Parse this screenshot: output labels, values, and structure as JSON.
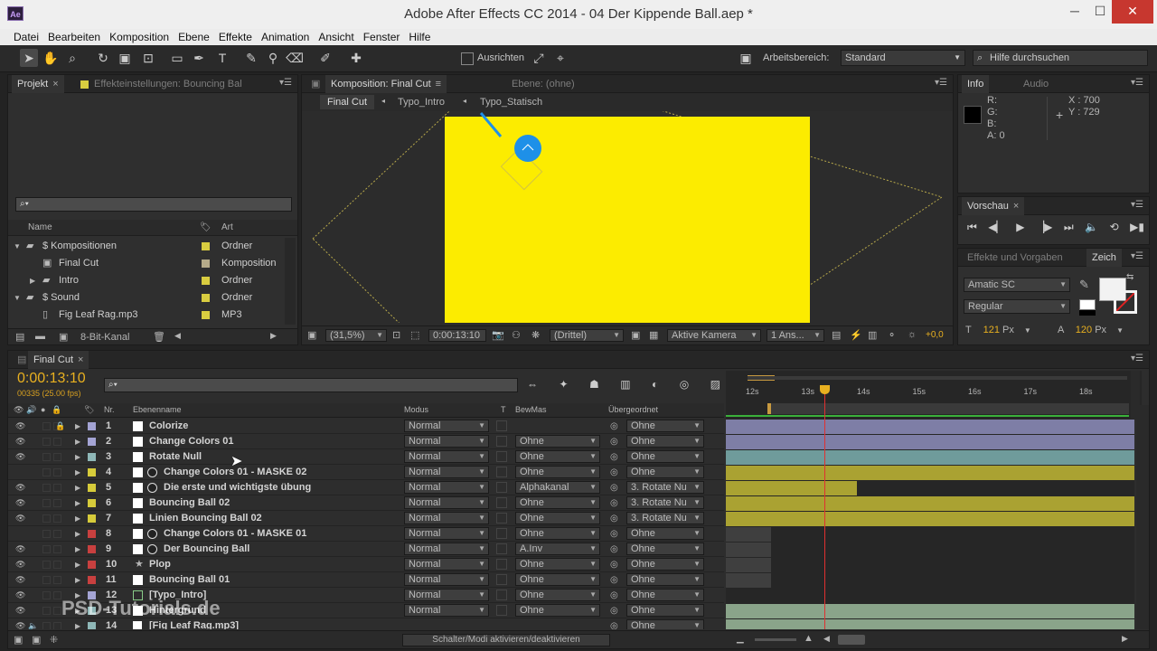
{
  "window": {
    "title": "Adobe After Effects CC 2014 - 04 Der Kippende Ball.aep *",
    "logo": "Ae",
    "min": "─",
    "max": "☐",
    "close": "✕"
  },
  "menu": [
    "Datei",
    "Bearbeiten",
    "Komposition",
    "Ebene",
    "Effekte",
    "Animation",
    "Ansicht",
    "Fenster",
    "Hilfe"
  ],
  "toolbar": {
    "align_label": "Ausrichten",
    "workspace_label": "Arbeitsbereich:",
    "workspace_value": "Standard",
    "help_search": "Hilfe durchsuchen"
  },
  "project": {
    "tab_project": "Projekt",
    "tab_effects": "Effekteinstellungen: Bouncing Bal",
    "search_placeholder": "⌕▾",
    "col_name": "Name",
    "col_type": "Art",
    "items": [
      {
        "name": "$ Kompositionen",
        "type": "Ordner",
        "color": "#d9cd40",
        "kind": "folder",
        "indent": 0
      },
      {
        "name": "Final Cut",
        "type": "Komposition",
        "color": "#b6ab8a",
        "kind": "comp",
        "indent": 1
      },
      {
        "name": "Intro",
        "type": "Ordner",
        "color": "#d9cd40",
        "kind": "folder",
        "indent": 1
      },
      {
        "name": "$ Sound",
        "type": "Ordner",
        "color": "#d9cd40",
        "kind": "folder",
        "indent": 0
      },
      {
        "name": "Fig Leaf Rag.mp3",
        "type": "MP3",
        "color": "#d9cd40",
        "kind": "file",
        "indent": 1
      }
    ],
    "bit_depth": "8-Bit-Kanal"
  },
  "composition": {
    "tab_comp": "Komposition: Final Cut",
    "tab_layer": "Ebene: (ohne)",
    "breadcrumbs": [
      "Final Cut",
      "Typo_Intro",
      "Typo_Statisch"
    ],
    "zoom": "(31,5%)",
    "timecode": "0:00:13:10",
    "grid": "(Drittel)",
    "camera": "Aktive Kamera",
    "views": "1 Ans...",
    "offset": "+0,0",
    "canvas_color": "#fcec00",
    "ball_color": "#1e90e8"
  },
  "info": {
    "tab_info": "Info",
    "tab_audio": "Audio",
    "r": "R:",
    "g": "G:",
    "b": "B:",
    "a": "A:",
    "a_val": "0",
    "x": "X : 700",
    "y": "Y : 729"
  },
  "preview": {
    "tab": "Vorschau"
  },
  "character": {
    "tab_effects": "Effekte und Vorgaben",
    "tab_char": "Zeich",
    "font": "Amatic SC",
    "style": "Regular",
    "size": "121",
    "size_unit": "Px",
    "leading": "120",
    "leading_unit": "Px"
  },
  "timeline": {
    "tab": "Final Cut",
    "timecode": "0:00:13:10",
    "frames": "00335 (25.00 fps)",
    "col_nr": "Nr.",
    "col_name": "Ebenenname",
    "col_mode": "Modus",
    "col_t": "T",
    "col_trkmat": "BewMas",
    "col_parent": "Übergeordnet",
    "ruler": [
      "12s",
      "13s",
      "14s",
      "15s",
      "16s",
      "17s",
      "18s",
      "1"
    ],
    "toggle_label": "Schalter/Modi aktivieren/deaktivieren",
    "layers": [
      {
        "nr": "1",
        "name": "Colorize",
        "mode": "Normal",
        "trkmat": "",
        "parent": "Ohne",
        "color": "#a4a4d4",
        "bar": "#7e7ea6",
        "start": 0.0,
        "end": 1.0
      },
      {
        "nr": "2",
        "name": "Change Colors 01",
        "mode": "Normal",
        "trkmat": "Ohne",
        "parent": "Ohne",
        "color": "#a4a4d4",
        "bar": "#7e7ea6",
        "start": 0.0,
        "end": 1.0
      },
      {
        "nr": "3",
        "name": "Rotate Null",
        "mode": "Normal",
        "trkmat": "Ohne",
        "parent": "Ohne",
        "color": "#8fb8b8",
        "bar": "#6f9b9b",
        "start": 0.0,
        "end": 1.0
      },
      {
        "nr": "4",
        "name": "Change Colors 01 - MASKE 02",
        "mode": "Normal",
        "trkmat": "Ohne",
        "parent": "Ohne",
        "color": "#d6cb3a",
        "bar": "#aaa232",
        "start": 0.0,
        "end": 1.0
      },
      {
        "nr": "5",
        "name": "Die erste und wichtigste übung",
        "mode": "Normal",
        "trkmat": "Alphakanal",
        "parent": "3. Rotate Nu",
        "color": "#d6cb3a",
        "bar": "#aaa232",
        "start": 0.0,
        "end": 0.32
      },
      {
        "nr": "6",
        "name": "Bouncing Ball 02",
        "mode": "Normal",
        "trkmat": "Ohne",
        "parent": "3. Rotate Nu",
        "color": "#d6cb3a",
        "bar": "#aaa232",
        "start": 0.0,
        "end": 1.0
      },
      {
        "nr": "7",
        "name": "Linien Bouncing Ball 02",
        "mode": "Normal",
        "trkmat": "Ohne",
        "parent": "3. Rotate Nu",
        "color": "#d6cb3a",
        "bar": "#aaa232",
        "start": 0.0,
        "end": 1.0
      },
      {
        "nr": "8",
        "name": "Change Colors 01 - MASKE 01",
        "mode": "Normal",
        "trkmat": "Ohne",
        "parent": "Ohne",
        "color": "#c8403f",
        "bar": "#3f3f3f",
        "start": 0.0,
        "end": 0.11
      },
      {
        "nr": "9",
        "name": "Der Bouncing Ball",
        "mode": "Normal",
        "trkmat": "A.Inv",
        "parent": "Ohne",
        "color": "#c8403f",
        "bar": "#3f3f3f",
        "start": 0.0,
        "end": 0.11
      },
      {
        "nr": "10",
        "name": "Plop",
        "mode": "Normal",
        "trkmat": "Ohne",
        "parent": "Ohne",
        "color": "#c8403f",
        "bar": "#3f3f3f",
        "start": 0.0,
        "end": 0.11
      },
      {
        "nr": "11",
        "name": "Bouncing Ball 01",
        "mode": "Normal",
        "trkmat": "Ohne",
        "parent": "Ohne",
        "color": "#c8403f",
        "bar": "#3f3f3f",
        "start": 0.0,
        "end": 0.11
      },
      {
        "nr": "12",
        "name": "[Typo_Intro]",
        "mode": "Normal",
        "trkmat": "Ohne",
        "parent": "Ohne",
        "color": "#a4a4d4",
        "bar": "#3a3a3a",
        "start": 0.0,
        "end": 0.0
      },
      {
        "nr": "13",
        "name": "Hintergrund",
        "mode": "Normal",
        "trkmat": "Ohne",
        "parent": "Ohne",
        "color": "#8fb8b8",
        "bar": "#8aa48a",
        "start": 0.0,
        "end": 1.0
      },
      {
        "nr": "14",
        "name": "[Fig Leaf Rag.mp3]",
        "mode": "",
        "trkmat": "",
        "parent": "Ohne",
        "color": "#8fb8b8",
        "bar": "#8aa48a",
        "start": 0.0,
        "end": 1.0
      }
    ]
  },
  "watermark": "PSD-Tutorials.de"
}
